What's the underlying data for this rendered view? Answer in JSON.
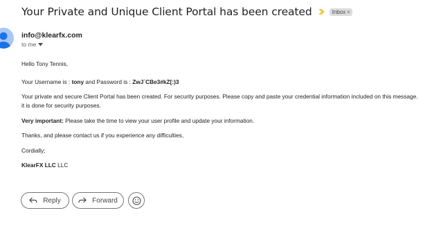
{
  "email": {
    "subject": "Your Private and Unique Client Portal has been created",
    "label_chip": "Inbox",
    "label_chip_close": "×",
    "sender": "info@klearfx.com",
    "recipient_summary": "to me",
    "greeting": "Hello Tony Tennis,",
    "credentials": {
      "prefix": "Your Username is : ",
      "username": "tony",
      "middle": " and Password is : ",
      "password": "ZwJ`CBe3#kZ[:)3"
    },
    "paragraph_1_line_1": "Your private and secure Client Portal has been created. For security purposes. Please copy and paste your credential information included on this message.",
    "paragraph_1_line_2": "it is done for security purposes.",
    "important_label": "Very important:",
    "important_text": " Please take the time to view your user profile and update your information.",
    "thanks": "Thanks, and please contact us if you experience any difficulties,",
    "closing": "Cordially;",
    "signature_bold": "KlearFX LLC",
    "signature_rest": " LLC"
  },
  "actions": {
    "reply_label": "Reply",
    "forward_label": "Forward"
  },
  "icons": {
    "important": "important-marker-icon",
    "avatar": "person-avatar-icon",
    "details": "chevron-down-icon",
    "reply": "reply-icon",
    "forward": "forward-icon",
    "emoji": "emoji-icon"
  },
  "colors": {
    "important_marker": "#f2c94c",
    "avatar_bg": "#a8c7fa",
    "avatar_fg": "#1a73e8"
  }
}
